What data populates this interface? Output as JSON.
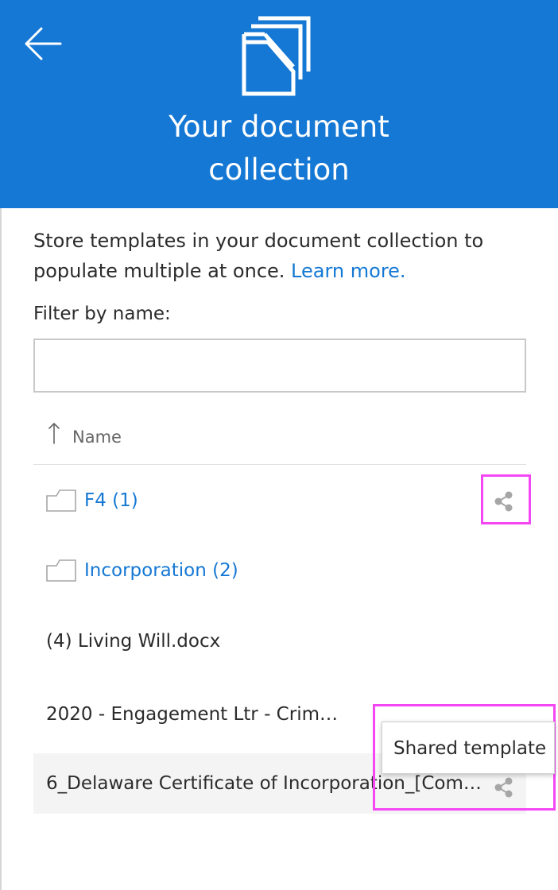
{
  "header": {
    "title_line1": "Your document",
    "title_line2": "collection",
    "back_icon": "back-arrow-icon",
    "logo_icon": "document-collection-icon",
    "background_color": "#1578d4"
  },
  "intro": {
    "text": "Store templates in your document collection to populate multiple at once. ",
    "link_text": "Learn more."
  },
  "filter": {
    "label": "Filter by name:",
    "value": "",
    "placeholder": ""
  },
  "list": {
    "sort_label": "Name",
    "sort_icon": "sort-up-arrow-icon",
    "items": [
      {
        "label": "F4 (1)",
        "type": "folder",
        "shared": true
      },
      {
        "label": "Incorporation (2)",
        "type": "folder",
        "shared": false
      },
      {
        "label": "(4) Living Will.docx",
        "type": "file",
        "shared": false
      },
      {
        "label": "2020 - Engagement Ltr - Crim…",
        "type": "file",
        "shared": false
      },
      {
        "label": "6_Delaware Certificate of Incorporation_[Com…",
        "type": "file",
        "shared": true,
        "selected": true
      }
    ]
  },
  "tooltip": {
    "text": "Shared template"
  },
  "colors": {
    "accent": "#1578d4",
    "highlight": "#f447f4",
    "icon_gray": "#a6a6a6"
  }
}
